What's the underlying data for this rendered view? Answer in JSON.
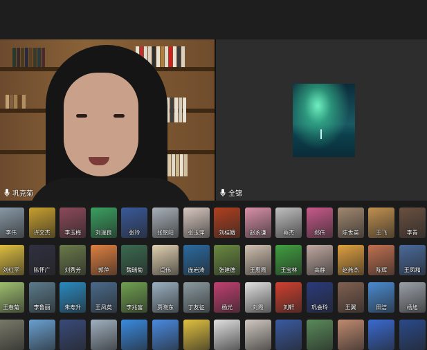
{
  "speaker_tile": {
    "name": "巩克菊"
  },
  "shared_tile": {
    "name": "全锦"
  },
  "participants": [
    [
      {
        "name": "李伟",
        "color": "#8a9aa8"
      },
      {
        "name": "许文杰",
        "color": "#c8a030"
      },
      {
        "name": "李玉梅",
        "color": "#8c4a5a"
      },
      {
        "name": "刘瑞良",
        "color": "#3aa060"
      },
      {
        "name": "张玲",
        "color": "#3a5a9a"
      },
      {
        "name": "张铭阳",
        "color": "#a8b0b8"
      },
      {
        "name": "张玉萍",
        "color": "#d8c8c0"
      },
      {
        "name": "刘桂娥",
        "color": "#b04020"
      },
      {
        "name": "赵永谦",
        "color": "#d890a8"
      },
      {
        "name": "蔡杰",
        "color": "#c0c0c0"
      },
      {
        "name": "郑伟",
        "color": "#c85a8a"
      },
      {
        "name": "陈世英",
        "color": "#a08870"
      },
      {
        "name": "王飞",
        "color": "#c09050"
      },
      {
        "name": "李青",
        "color": "#6a5040"
      }
    ],
    [
      {
        "name": "刘红平",
        "color": "#e0c040"
      },
      {
        "name": "陈怀广",
        "color": "#303040"
      },
      {
        "name": "刘秀芳",
        "color": "#6a7a4a"
      },
      {
        "name": "郭萍",
        "color": "#e08040"
      },
      {
        "name": "魏瑞菊",
        "color": "#3a6a50"
      },
      {
        "name": "闫伟",
        "color": "#e0d0b0"
      },
      {
        "name": "庞岩涛",
        "color": "#2a6aa0"
      },
      {
        "name": "张建德",
        "color": "#6a8a40"
      },
      {
        "name": "王惠霞",
        "color": "#d0c0b0"
      },
      {
        "name": "王宝林",
        "color": "#40a040"
      },
      {
        "name": "高静",
        "color": "#c0a8a0"
      },
      {
        "name": "赵燕杰",
        "color": "#e0a040"
      },
      {
        "name": "陈辉",
        "color": "#c07050"
      },
      {
        "name": "王凤和",
        "color": "#4a6a9a"
      }
    ],
    [
      {
        "name": "王春菊",
        "color": "#a0c070"
      },
      {
        "name": "李鲁丽",
        "color": "#5a7a8a"
      },
      {
        "name": "朱寿升",
        "color": "#2a8ac0"
      },
      {
        "name": "王凤英",
        "color": "#4a6a8a"
      },
      {
        "name": "李兆富",
        "color": "#70a050"
      },
      {
        "name": "贾晓东",
        "color": "#9ab0c0"
      },
      {
        "name": "丁友征",
        "color": "#8a9aa0"
      },
      {
        "name": "杨光",
        "color": "#c04070"
      },
      {
        "name": "刘霞",
        "color": "#e0e0e0"
      },
      {
        "name": "刘轩",
        "color": "#d04030"
      },
      {
        "name": "巩会玲",
        "color": "#2a3a7a"
      },
      {
        "name": "王翼",
        "color": "#806050"
      },
      {
        "name": "田洁",
        "color": "#4a8ad0"
      },
      {
        "name": "杨旭",
        "color": "#9aa0a8"
      }
    ],
    [
      {
        "name": "",
        "color": "#7a7a6a"
      },
      {
        "name": "",
        "color": "#6aa0d0"
      },
      {
        "name": "",
        "color": "#3a4a7a"
      },
      {
        "name": "",
        "color": "#a0b0c0"
      },
      {
        "name": "",
        "color": "#3a8ae0"
      },
      {
        "name": "",
        "color": "#4a8ae0"
      },
      {
        "name": "",
        "color": "#e0c040"
      },
      {
        "name": "",
        "color": "#e0e0e0"
      },
      {
        "name": "",
        "color": "#d0c8c0"
      },
      {
        "name": "",
        "color": "#3a5aa0"
      },
      {
        "name": "",
        "color": "#5a8a5a"
      },
      {
        "name": "",
        "color": "#c08a70"
      },
      {
        "name": "",
        "color": "#3a6ad0"
      },
      {
        "name": "",
        "color": "#2a4a8a"
      }
    ]
  ]
}
